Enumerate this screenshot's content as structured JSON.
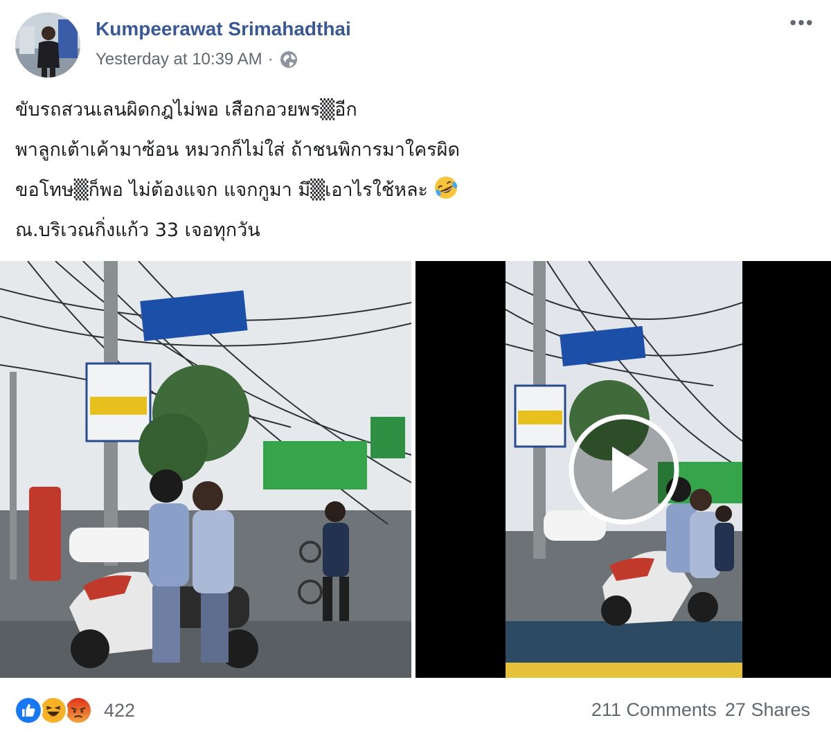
{
  "post": {
    "author": "Kumpeerawat Srimahadthai",
    "timestamp": "Yesterday at 10:39 AM",
    "separator": "·",
    "privacy_icon": "globe-icon",
    "more_icon": "more-options-icon",
    "more_label": "•••",
    "text_lines": [
      "ขับรถสวนเลนผิดกฎไม่พอ เสือกอวยพร▒อีก",
      "พาลูกเต้าเค้ามาซ้อน หมวกก็ไม่ใส่ ถ้าชนพิการมาใครผิด",
      "ขอโทษ▒ก็พอ ไม่ต้องแจก แจกกูมา มึ▒เอาไรใช้หละ",
      "ณ.บริเวณกิ่งแก้ว 33 เจอทุกวัน"
    ],
    "emoji": "rofl-emoji"
  },
  "media": {
    "photo_icon": "dashcam-photo",
    "video_play_icon": "play-icon"
  },
  "footer": {
    "reactions": [
      "like-reaction-icon",
      "haha-reaction-icon",
      "angry-reaction-icon"
    ],
    "reaction_count": "422",
    "comments": "211 Comments",
    "shares": "27 Shares"
  },
  "colors": {
    "author": "#385898",
    "meta": "#616770",
    "like": "#1877f2",
    "haha": "#f7b125",
    "angry": "#e9710f"
  }
}
